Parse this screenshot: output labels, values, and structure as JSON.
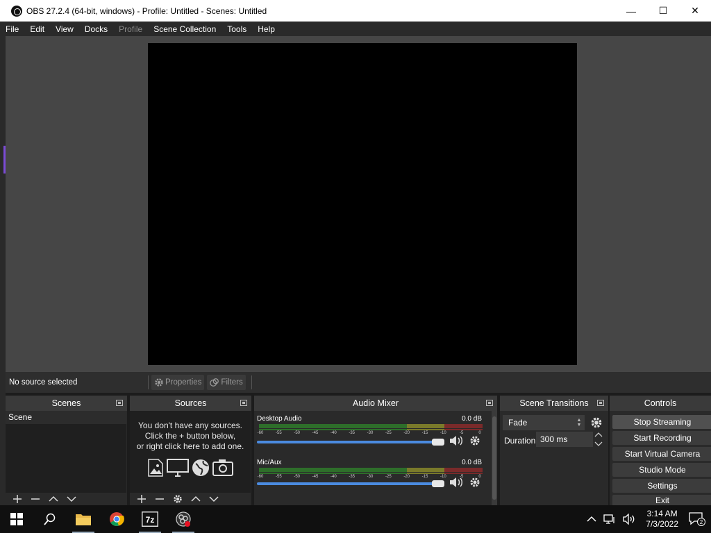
{
  "window": {
    "title": "OBS 27.2.4 (64-bit, windows) - Profile: Untitled - Scenes: Untitled",
    "minimize": "—",
    "maximize": "☐",
    "close": "✕"
  },
  "menu": {
    "items": [
      "File",
      "Edit",
      "View",
      "Docks",
      "Profile",
      "Scene Collection",
      "Tools",
      "Help"
    ]
  },
  "source_toolbar": {
    "no_source": "No source selected",
    "properties": "Properties",
    "filters": "Filters"
  },
  "scenes": {
    "title": "Scenes",
    "items": [
      "Scene"
    ]
  },
  "sources": {
    "title": "Sources",
    "empty_line1": "You don't have any sources.",
    "empty_line2": "Click the + button below,",
    "empty_line3": "or right click here to add one."
  },
  "mixer": {
    "title": "Audio Mixer",
    "channels": [
      {
        "name": "Desktop Audio",
        "db": "0.0 dB",
        "volume_fraction": 1.0
      },
      {
        "name": "Mic/Aux",
        "db": "0.0 dB",
        "volume_fraction": 1.0
      }
    ],
    "scale": [
      "-60",
      "-55",
      "-50",
      "-45",
      "-40",
      "-35",
      "-30",
      "-25",
      "-20",
      "-15",
      "-10",
      "-5",
      "0"
    ]
  },
  "transitions": {
    "title": "Scene Transitions",
    "selected": "Fade",
    "duration_label": "Duration",
    "duration_value": "300 ms"
  },
  "controls": {
    "title": "Controls",
    "buttons": [
      "Stop Streaming",
      "Start Recording",
      "Start Virtual Camera",
      "Studio Mode",
      "Settings",
      "Exit"
    ]
  },
  "taskbar": {
    "time": "3:14 AM",
    "date": "7/3/2022",
    "notifications": "2",
    "seven_zip": "7z"
  },
  "colors": {
    "accent_slider": "#4b8be0",
    "meter_green": "#2e6e2a",
    "meter_yellow": "#7a7a2a",
    "meter_red": "#7a2a2a"
  }
}
